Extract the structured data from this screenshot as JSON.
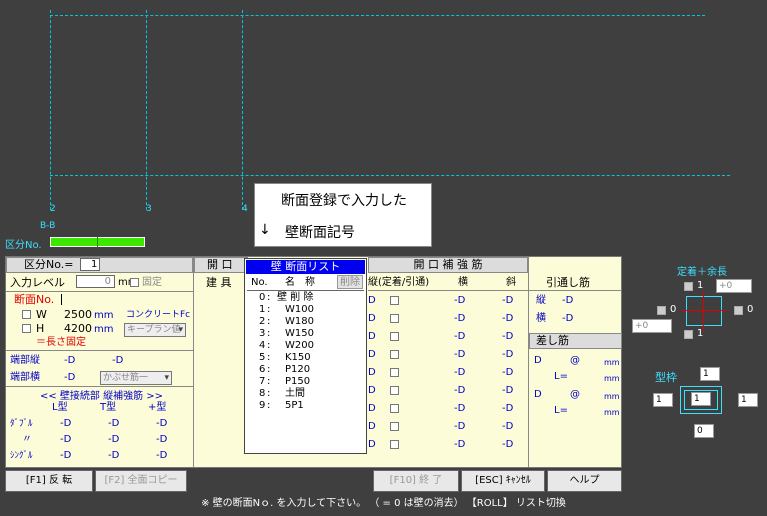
{
  "grid": {
    "labels": [
      "2",
      "3",
      "4"
    ],
    "section": "B-B"
  },
  "kubun_bar_label": "区分No.",
  "callout": {
    "line1": "断面登録で入力した",
    "arrow": "↓",
    "line2": "壁断面記号"
  },
  "panel": {
    "kubun_label": "区分No.=",
    "kubun_value": "1",
    "input_level_label": "入力レベル",
    "input_level_value": "0",
    "mm_unit": "mm",
    "fixed_label": "固定",
    "danmen_label": "断面No.",
    "w_label": "W",
    "w_value": "2500",
    "h_label": "H",
    "h_value": "4200",
    "unit_mm": "mm",
    "concrete_label": "コンクリートFc",
    "concrete_select": "キープラン値",
    "length_fixed": "＝長さ固定",
    "tanbu_tate_label": "端部縦",
    "tanbu_yoko_label": "端部横",
    "d1": "-D",
    "d2": "-D",
    "d3": "-D",
    "kabuse_select": "かぶせ筋一",
    "wall_joint_header": "<< 壁接続部 縦補強筋 >>",
    "col_l": "L型",
    "col_t": "T型",
    "col_plus": "+型",
    "row_double": "ﾀﾞﾌﾞﾙ",
    "row_same": "〃",
    "row_single": "ｼﾝｸﾞﾙ",
    "dash_d": "-D",
    "kaiko_header": "開 口",
    "tategu_header": "建 具",
    "kaiko_hokyo_header": "開 口 補 強 筋",
    "tate_col": "縦(定着/引通)",
    "yoko_col": "横",
    "naname_col": "斜",
    "hikitoshi_header": "引通し筋",
    "hikitoshi_tate": "縦",
    "hikitoshi_yoko": "横",
    "sashikin_header": "差し筋",
    "sashi_d": "D",
    "sashi_at": "@",
    "sashi_l": "L=",
    "sashi_mm": "mm"
  },
  "popup": {
    "title": "壁 断面リスト",
    "col_no": "No.",
    "col_name": "名　称",
    "col_del": "削除",
    "items": [
      {
        "no": "0",
        "name": "壁 削 除"
      },
      {
        "no": "1",
        "name": "W100"
      },
      {
        "no": "2",
        "name": "W180"
      },
      {
        "no": "3",
        "name": "W150"
      },
      {
        "no": "4",
        "name": "W200"
      },
      {
        "no": "5",
        "name": "K150"
      },
      {
        "no": "6",
        "name": "P120"
      },
      {
        "no": "7",
        "name": "P150"
      },
      {
        "no": "8",
        "name": "土間"
      },
      {
        "no": "9",
        "name": "5P1"
      }
    ]
  },
  "right_panel": {
    "teichaku_label": "定着＋余長",
    "top_val": "+0",
    "left_val": "+0",
    "one": "1",
    "zero": "0",
    "katawaku_label": "型枠",
    "kw_top": "1",
    "kw_left": "1",
    "kw_center": "1",
    "kw_right": "1",
    "kw_bottom": "0"
  },
  "buttons": {
    "f1": "[F1] 反 転",
    "f2": "[F2] 全面コピー",
    "f10": "[F10] 終 了",
    "esc": "[ESC] ｷｬﾝｾﾙ",
    "help": "ヘルプ"
  },
  "status": "※ 壁の断面Nｏ. を入力して下さい。 （ = 0 は壁の消去） 【ROLL】 リスト切換"
}
